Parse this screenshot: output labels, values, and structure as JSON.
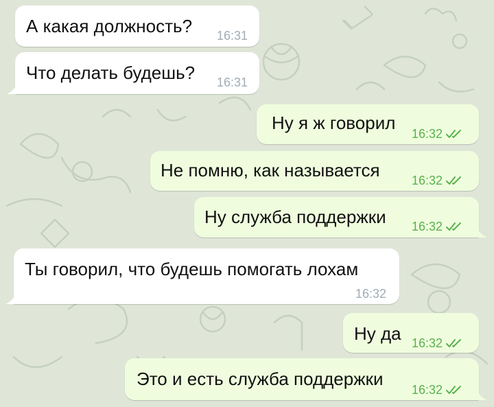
{
  "theme": {
    "incoming_bg": "#ffffff",
    "outgoing_bg": "#effdde",
    "outgoing_time_color": "#59b24d",
    "incoming_time_color": "#a0acb6",
    "wallpaper_color": "#dfe6d8"
  },
  "messages": [
    {
      "direction": "incoming",
      "text": "А какая должность?",
      "time": "16:31"
    },
    {
      "direction": "incoming",
      "text": "Что делать будешь?",
      "time": "16:31"
    },
    {
      "direction": "outgoing",
      "text": "Ну я ж говорил",
      "time": "16:32",
      "status": "read-double-check-icon"
    },
    {
      "direction": "outgoing",
      "text": "Не помню, как называется",
      "time": "16:32",
      "status": "read-double-check-icon"
    },
    {
      "direction": "outgoing",
      "text": "Ну служба поддержки",
      "time": "16:32",
      "status": "read-double-check-icon"
    },
    {
      "direction": "incoming",
      "text": "Ты говорил, что будешь помогать лохам",
      "time": "16:32"
    },
    {
      "direction": "outgoing",
      "text": "Ну да",
      "time": "16:32",
      "status": "read-double-check-icon"
    },
    {
      "direction": "outgoing",
      "text": "Это и есть служба поддержки",
      "time": "16:32",
      "status": "read-double-check-icon"
    }
  ]
}
